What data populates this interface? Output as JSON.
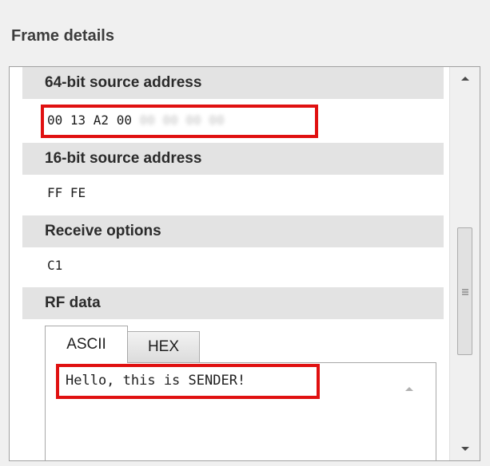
{
  "panel": {
    "title": "Frame details"
  },
  "sections": [
    {
      "header": "64-bit source address",
      "value": "00 13 A2 00",
      "value_masked": "00 00 00 00"
    },
    {
      "header": "16-bit source address",
      "value": "FF FE"
    },
    {
      "header": "Receive options",
      "value": "C1"
    },
    {
      "header": "RF data"
    }
  ],
  "rf_data": {
    "tabs": [
      {
        "label": "ASCII",
        "active": true
      },
      {
        "label": "HEX",
        "active": false
      }
    ],
    "content": "Hello, this is SENDER!"
  },
  "colors": {
    "highlight": "#e01010",
    "header_bg": "#e3e3e3"
  },
  "icons": {
    "scroll_up": "scroll-up-arrow-icon",
    "scroll_down": "scroll-down-arrow-icon",
    "grip": "grip-lines-icon"
  }
}
